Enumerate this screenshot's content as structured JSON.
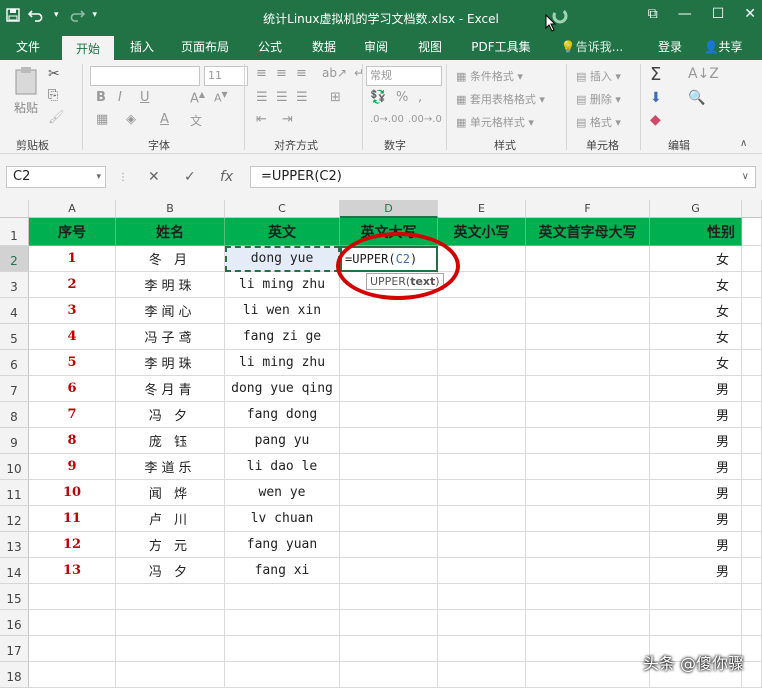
{
  "titlebar": {
    "title": "统计Linux虚拟机的学习文档数.xlsx - Excel",
    "save_icon": "save-icon",
    "undo_icon": "undo-icon",
    "redo_icon": "redo-icon",
    "more": "▾",
    "win_restore": "⧉",
    "win_min": "—",
    "win_max": "☐",
    "win_close": "✕"
  },
  "tabs": [
    "文件",
    "开始",
    "插入",
    "页面布局",
    "公式",
    "数据",
    "审阅",
    "视图",
    "PDF工具集"
  ],
  "tell_me": "告诉我...",
  "login": "登录",
  "share": "共享",
  "ribbon": {
    "paste": "粘贴",
    "font_size": "11",
    "bold": "B",
    "italic": "I",
    "underline": "U",
    "number_format": "常规",
    "cond_format": "条件格式",
    "table_format": "套用表格格式",
    "cell_style": "单元格样式",
    "insert": "插入",
    "delete": "删除",
    "format": "格式",
    "sum": "Σ",
    "groups": [
      "剪贴板",
      "字体",
      "对齐方式",
      "数字",
      "样式",
      "单元格",
      "编辑"
    ]
  },
  "formula_bar": {
    "name_box": "C2",
    "cancel": "✕",
    "enter": "✓",
    "fx": "fx",
    "formula": "=UPPER(C2)"
  },
  "columns": [
    "A",
    "B",
    "C",
    "D",
    "E",
    "F",
    "G"
  ],
  "rows": [
    "1",
    "2",
    "3",
    "4",
    "5",
    "6",
    "7",
    "8",
    "9",
    "10",
    "11",
    "12",
    "13",
    "14",
    "15",
    "16",
    "17",
    "18"
  ],
  "headers": [
    "序号",
    "姓名",
    "英文",
    "英文大写",
    "英文小写",
    "英文首字母大写",
    "性别"
  ],
  "data": [
    {
      "no": "1",
      "name": "冬 月",
      "en": "dong yue",
      "sex": "女"
    },
    {
      "no": "2",
      "name": "李明珠",
      "en": "li ming zhu",
      "sex": "女"
    },
    {
      "no": "3",
      "name": "李闻心",
      "en": "li wen xin",
      "sex": "女"
    },
    {
      "no": "4",
      "name": "冯子鸢",
      "en": "fang zi ge",
      "sex": "女"
    },
    {
      "no": "5",
      "name": "李明珠",
      "en": "li ming zhu",
      "sex": "女"
    },
    {
      "no": "6",
      "name": "冬月青",
      "en": "dong yue qing",
      "sex": "男"
    },
    {
      "no": "7",
      "name": "冯 夕",
      "en": "fang dong",
      "sex": "男"
    },
    {
      "no": "8",
      "name": "庞 钰",
      "en": "pang yu",
      "sex": "男"
    },
    {
      "no": "9",
      "name": "李道乐",
      "en": "li dao le",
      "sex": "男"
    },
    {
      "no": "10",
      "name": "闻 烨",
      "en": "wen ye",
      "sex": "男"
    },
    {
      "no": "11",
      "name": "卢 川",
      "en": "lv chuan",
      "sex": "男"
    },
    {
      "no": "12",
      "name": "方 元",
      "en": "fang yuan",
      "sex": "男"
    },
    {
      "no": "13",
      "name": "冯 夕",
      "en": "fang xi",
      "sex": "男"
    }
  ],
  "edit_cell": {
    "prefix": "=UPPER(",
    "ref": "C2",
    "suffix": ")"
  },
  "tooltip": {
    "fn": "UPPER(",
    "arg": "text",
    "close": ")"
  },
  "watermark": "头条 @傻你骤"
}
